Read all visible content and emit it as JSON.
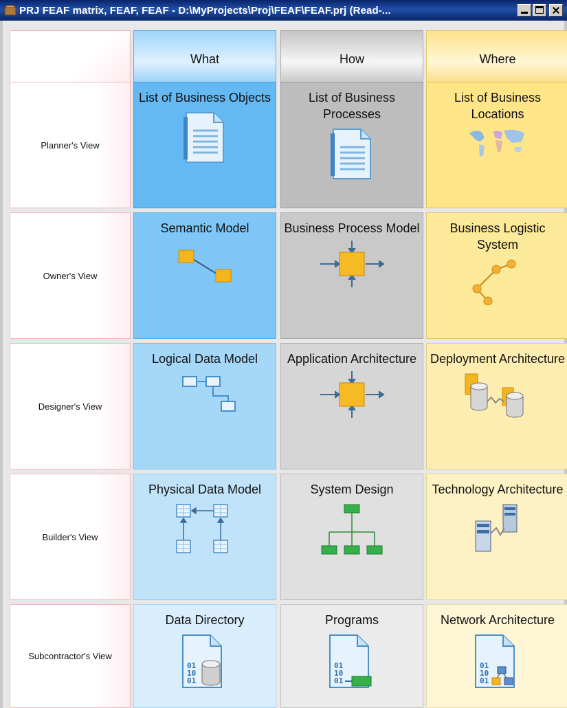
{
  "window": {
    "title": "PRJ FEAF matrix, FEAF, FEAF - D:\\MyProjects\\Proj\\FEAF\\FEAF.prj (Read-..."
  },
  "columns": [
    "What",
    "How",
    "Where"
  ],
  "rows": [
    {
      "label": "Planner's View",
      "cells": [
        {
          "label": "List of Business Objects",
          "icon": "document-icon"
        },
        {
          "label": "List of Business Processes",
          "icon": "document-icon"
        },
        {
          "label": "List of Business Locations",
          "icon": "world-map-icon"
        }
      ]
    },
    {
      "label": "Owner's View",
      "cells": [
        {
          "label": "Semantic Model",
          "icon": "semantic-model-icon"
        },
        {
          "label": "Business Process Model",
          "icon": "process-box-icon"
        },
        {
          "label": "Business Logistic System",
          "icon": "network-nodes-icon"
        }
      ]
    },
    {
      "label": "Designer's View",
      "cells": [
        {
          "label": "Logical Data Model",
          "icon": "entity-relation-icon"
        },
        {
          "label": "Application Architecture",
          "icon": "process-box-icon"
        },
        {
          "label": "Deployment Architecture",
          "icon": "database-server-icon"
        }
      ]
    },
    {
      "label": "Builder's View",
      "cells": [
        {
          "label": "Physical Data Model",
          "icon": "table-schema-icon"
        },
        {
          "label": "System Design",
          "icon": "hierarchy-icon"
        },
        {
          "label": "Technology Architecture",
          "icon": "server-connection-icon"
        }
      ]
    },
    {
      "label": "Subcontractor's View",
      "cells": [
        {
          "label": "Data Directory",
          "icon": "binary-document-database-icon"
        },
        {
          "label": "Programs",
          "icon": "binary-document-chip-icon"
        },
        {
          "label": "Network Architecture",
          "icon": "binary-document-network-icon"
        }
      ]
    }
  ]
}
